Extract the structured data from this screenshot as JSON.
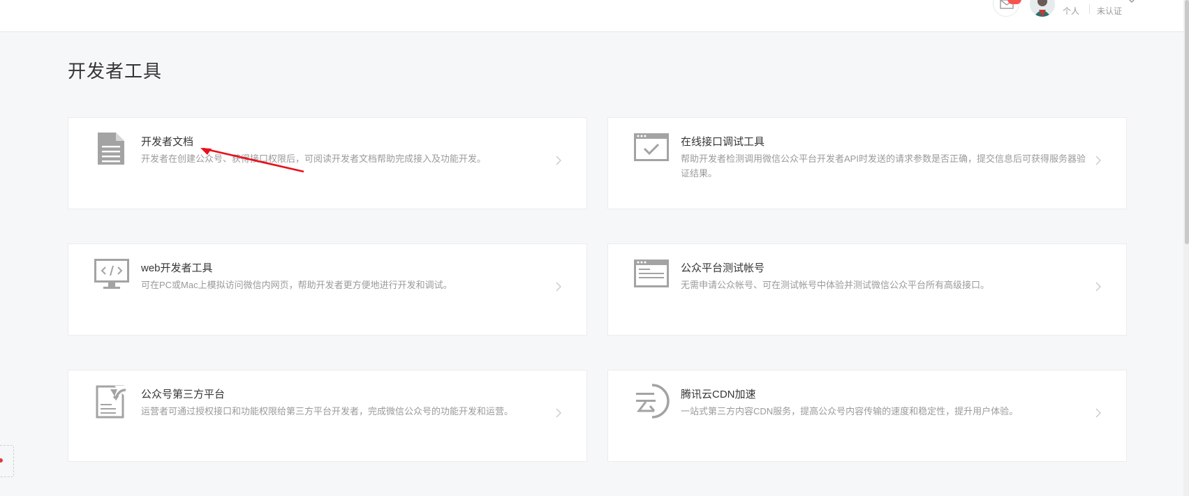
{
  "header": {
    "account_type": "个人",
    "verify_status": "未认证"
  },
  "page": {
    "title": "开发者工具"
  },
  "cards": [
    {
      "title": "开发者文档",
      "desc": "开发者在创建公众号、获得接口权限后，可阅读开发者文档帮助完成接入及功能开发。",
      "icon": "document-icon"
    },
    {
      "title": "在线接口调试工具",
      "desc": "帮助开发者检测调用微信公众平台开发者API时发送的请求参数是否正确，提交信息后可获得服务器验证结果。",
      "icon": "browser-check-icon"
    },
    {
      "title": "web开发者工具",
      "desc": "可在PC或Mac上模拟访问微信内网页，帮助开发者更方便地进行开发和调试。",
      "icon": "monitor-code-icon"
    },
    {
      "title": "公众平台测试帐号",
      "desc": "无需申请公众帐号、可在测试帐号中体验并测试微信公众平台所有高级接口。",
      "icon": "browser-window-icon"
    },
    {
      "title": "公众号第三方平台",
      "desc": "运营者可通过授权接口和功能权限给第三方平台开发者，完成微信公众号的功能开发和运营。",
      "icon": "document-share-icon"
    },
    {
      "title": "腾讯云CDN加速",
      "desc": "一站式第三方内容CDN服务，提高公众号内容传输的速度和稳定性，提升用户体验。",
      "icon": "cloud-icon"
    }
  ],
  "colors": {
    "background": "#f6f7f9",
    "card": "#ffffff",
    "icon_gray": "#a3a3a3",
    "annotation_red": "#e8101a",
    "badge_red": "#fa5151"
  }
}
